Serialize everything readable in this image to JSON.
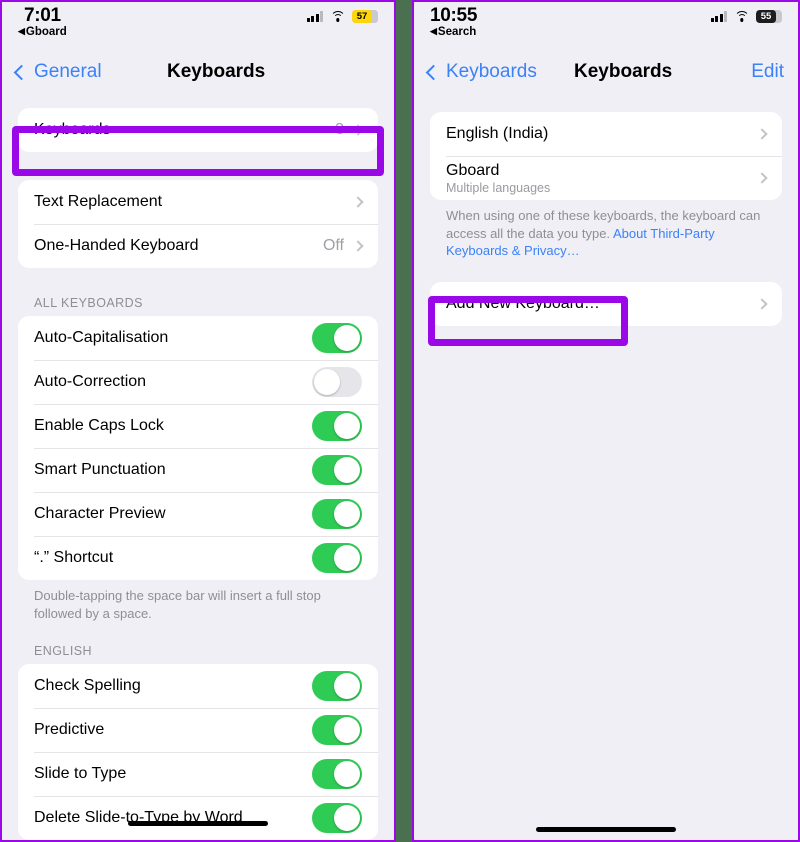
{
  "left": {
    "status": {
      "time": "7:01",
      "back_label": "Gboard",
      "battery": "57",
      "battery_style": "yellow"
    },
    "nav": {
      "back": "General",
      "title": "Keyboards"
    },
    "group1": [
      {
        "label": "Keyboards",
        "value": "3",
        "type": "disclosure"
      }
    ],
    "group2": [
      {
        "label": "Text Replacement",
        "value": "",
        "type": "disclosure"
      },
      {
        "label": "One-Handed Keyboard",
        "value": "Off",
        "type": "disclosure"
      }
    ],
    "all_keyboards_header": "ALL KEYBOARDS",
    "group3": [
      {
        "label": "Auto-Capitalisation",
        "state": "on"
      },
      {
        "label": "Auto-Correction",
        "state": "off"
      },
      {
        "label": "Enable Caps Lock",
        "state": "on"
      },
      {
        "label": "Smart Punctuation",
        "state": "on"
      },
      {
        "label": "Character Preview",
        "state": "on"
      },
      {
        "label": "“.” Shortcut",
        "state": "on"
      }
    ],
    "group3_footer": "Double-tapping the space bar will insert a full stop followed by a space.",
    "english_header": "ENGLISH",
    "group4": [
      {
        "label": "Check Spelling",
        "state": "on"
      },
      {
        "label": "Predictive",
        "state": "on"
      },
      {
        "label": "Slide to Type",
        "state": "on"
      },
      {
        "label": "Delete Slide-to-Type by Word",
        "state": "on"
      }
    ]
  },
  "right": {
    "status": {
      "time": "10:55",
      "back_label": "Search",
      "battery": "55",
      "battery_style": "dark"
    },
    "nav": {
      "back": "Keyboards",
      "title": "Keyboards",
      "edit": "Edit"
    },
    "group1": [
      {
        "label": "English (India)",
        "sub": ""
      },
      {
        "label": "Gboard",
        "sub": "Multiple languages"
      }
    ],
    "privacy_footer_text": "When using one of these keyboards, the keyboard can access all the data you type. ",
    "privacy_footer_link": "About Third-Party Keyboards & Privacy…",
    "group2": [
      {
        "label": "Add New Keyboard…"
      }
    ]
  },
  "colors": {
    "highlight": "#9a08e8",
    "toggle_on": "#2ecb55",
    "accent_blue": "#3b82f6"
  }
}
